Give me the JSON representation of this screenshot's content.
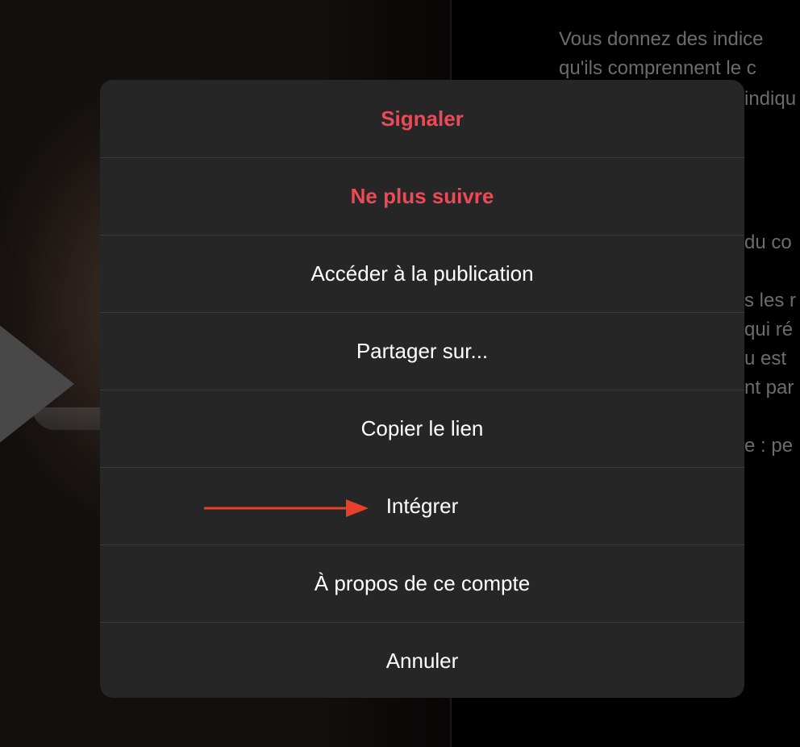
{
  "caption": {
    "lines": [
      "Vous donnez des indice",
      "qu'ils comprennent le c",
      "indiqu",
      "du co",
      "s les r",
      "qui ré",
      "u est",
      "nt par",
      "e : pe"
    ]
  },
  "action_sheet": {
    "items": [
      {
        "label": "Signaler",
        "style": "danger"
      },
      {
        "label": "Ne plus suivre",
        "style": "danger"
      },
      {
        "label": "Accéder à la publication",
        "style": "default"
      },
      {
        "label": "Partager sur...",
        "style": "default"
      },
      {
        "label": "Copier le lien",
        "style": "default"
      },
      {
        "label": "Intégrer",
        "style": "default"
      },
      {
        "label": "À propos de ce compte",
        "style": "default"
      },
      {
        "label": "Annuler",
        "style": "default"
      }
    ]
  },
  "annotation": {
    "arrow_color": "#e8402a",
    "arrow_target": "Intégrer"
  },
  "colors": {
    "sheet_bg": "#262626",
    "danger": "#ed4956",
    "text": "#ffffff",
    "separator": "#3b3b3b"
  },
  "icons": {
    "play": "play-icon",
    "arrow": "arrow-right-icon"
  }
}
